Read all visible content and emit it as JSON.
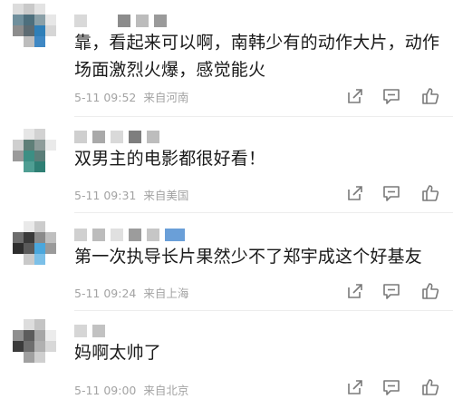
{
  "comments": [
    {
      "text": "靠，看起来可以啊，南韩少有的动作大片，动作场面激烈火爆，感觉能火",
      "time": "5-11 09:52",
      "location": "来自河南"
    },
    {
      "text": "双男主的电影都很好看！",
      "time": "5-11 09:31",
      "location": "来自美国"
    },
    {
      "text": "第一次执导长片果然少不了郑宇成这个好基友",
      "time": "5-11 09:24",
      "location": "来自上海"
    },
    {
      "text": "妈啊太帅了",
      "time": "5-11 09:00",
      "location": "来自北京"
    }
  ],
  "icons": {
    "share": "share-icon",
    "reply": "comment-icon",
    "like": "thumbs-up-icon"
  },
  "colors": {
    "text": "#1a1a1a",
    "meta": "#a3a3a3",
    "icon": "#7a7a7a"
  }
}
